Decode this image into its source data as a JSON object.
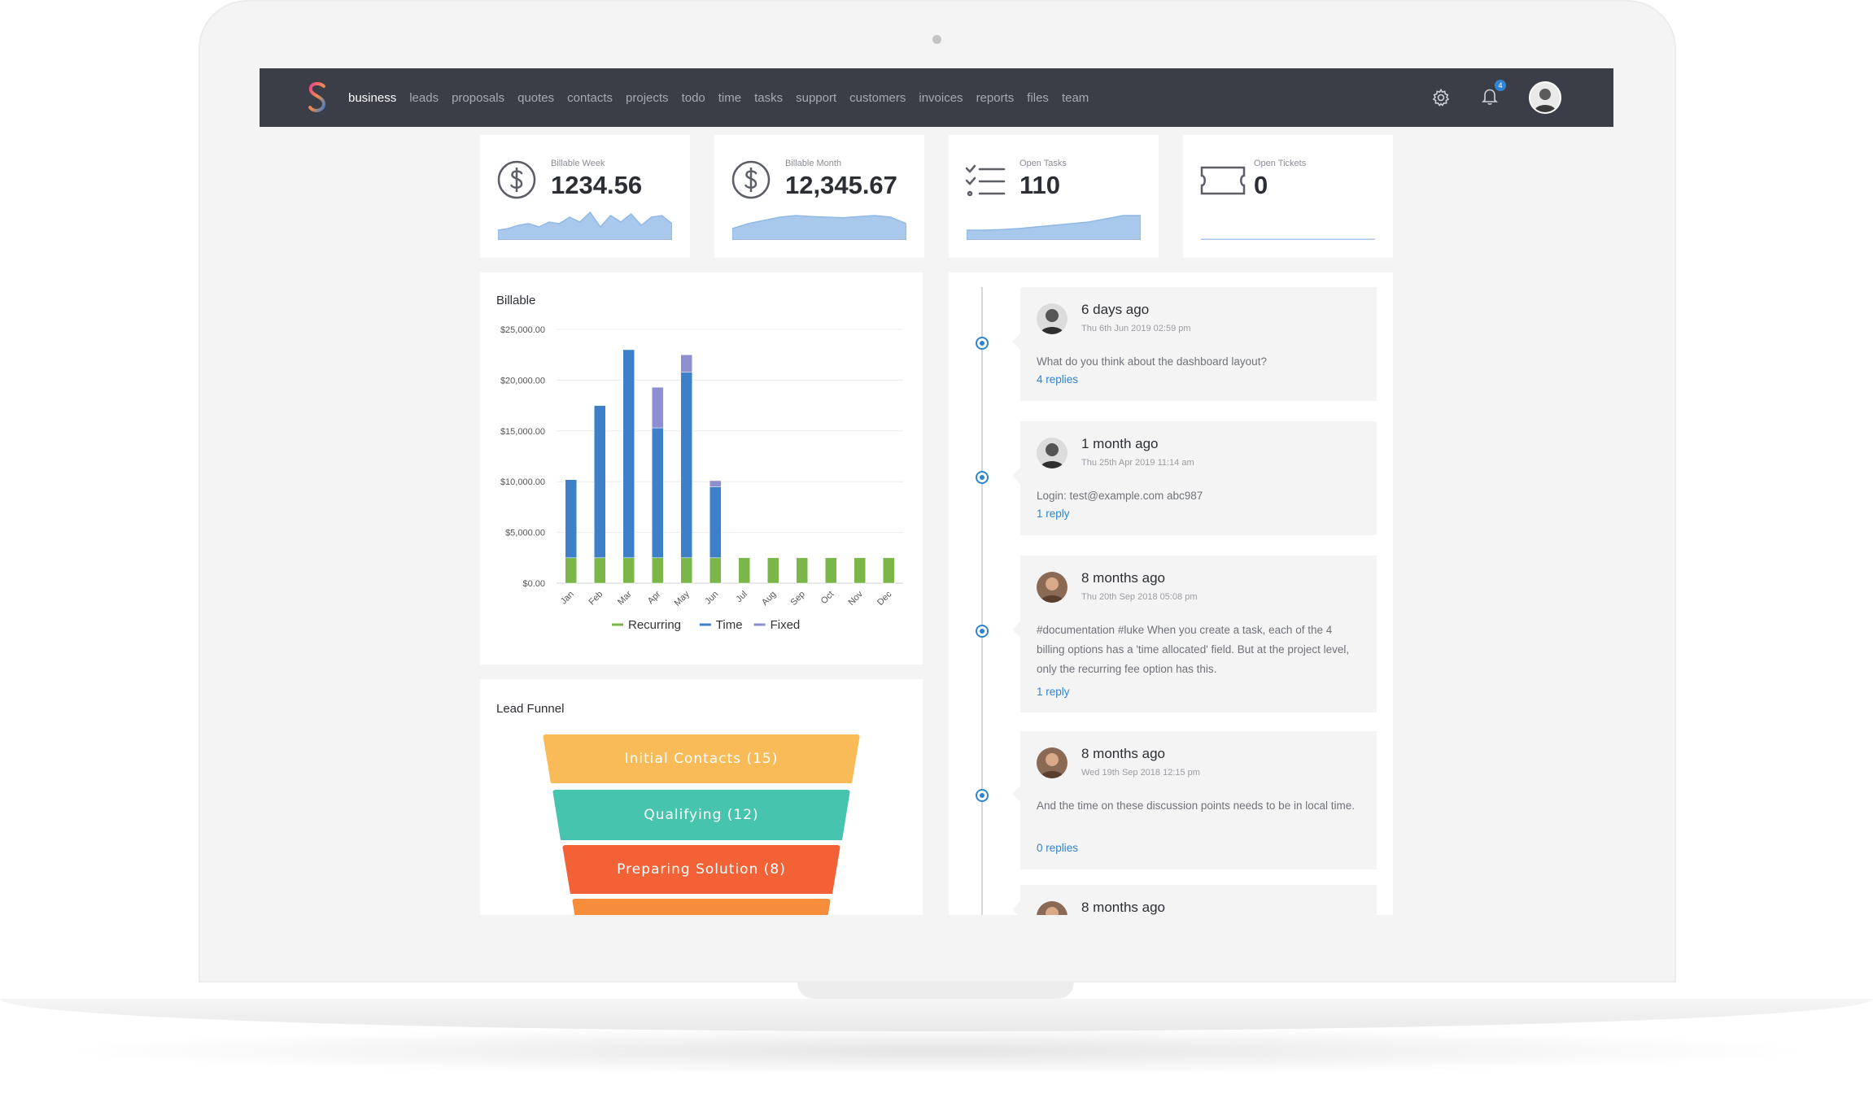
{
  "nav": {
    "items": [
      {
        "label": "business",
        "active": true
      },
      {
        "label": "leads"
      },
      {
        "label": "proposals"
      },
      {
        "label": "quotes"
      },
      {
        "label": "contacts"
      },
      {
        "label": "projects"
      },
      {
        "label": "todo"
      },
      {
        "label": "time"
      },
      {
        "label": "tasks"
      },
      {
        "label": "support"
      },
      {
        "label": "customers"
      },
      {
        "label": "invoices"
      },
      {
        "label": "reports"
      },
      {
        "label": "files"
      },
      {
        "label": "team"
      }
    ],
    "notification_count": "4",
    "icons": [
      "logo-s-icon",
      "settings-gear-icon",
      "bell-icon",
      "avatar"
    ]
  },
  "stats": [
    {
      "label": "Billable Week",
      "value": "1234.56",
      "icon": "dollar-circle-icon"
    },
    {
      "label": "Billable Month",
      "value": "12,345.67",
      "icon": "dollar-circle-icon"
    },
    {
      "label": "Open Tasks",
      "value": "110",
      "icon": "checklist-icon"
    },
    {
      "label": "Open Tickets",
      "value": "0",
      "icon": "ticket-icon"
    }
  ],
  "billable_card": {
    "title": "Billable"
  },
  "lead_funnel": {
    "title": "Lead Funnel",
    "levels": [
      {
        "label": "Initial Contacts (15)",
        "color": "#f8bb57"
      },
      {
        "label": "Qualifying (12)",
        "color": "#47c4ad"
      },
      {
        "label": "Preparing Solution (8)",
        "color": "#f26236"
      },
      {
        "label": "",
        "color": "#f68d3a"
      }
    ]
  },
  "chart_data": {
    "type": "bar",
    "stacked": true,
    "title": "Billable",
    "categories": [
      "Jan",
      "Feb",
      "Mar",
      "Apr",
      "May",
      "Jun",
      "Jul",
      "Aug",
      "Sep",
      "Oct",
      "Nov",
      "Dec"
    ],
    "series": [
      {
        "name": "Recurring",
        "color": "#7ab648",
        "values": [
          2500,
          2500,
          2500,
          2500,
          2500,
          2500,
          2500,
          2500,
          2500,
          2500,
          2500,
          2500
        ]
      },
      {
        "name": "Time",
        "color": "#3d7fc9",
        "values": [
          7700,
          15000,
          20500,
          12800,
          18300,
          7000,
          0,
          0,
          0,
          0,
          0,
          0
        ]
      },
      {
        "name": "Fixed",
        "color": "#8e8fd0",
        "values": [
          0,
          0,
          0,
          4000,
          1700,
          600,
          0,
          0,
          0,
          0,
          0,
          0
        ]
      }
    ],
    "y_ticks": [
      "$0.00",
      "$5,000.00",
      "$10,000.00",
      "$15,000.00",
      "$20,000.00",
      "$25,000.00"
    ],
    "ylim": [
      0,
      25000
    ],
    "legend_position": "bottom",
    "grid": true
  },
  "timeline": [
    {
      "ago": "6 days ago",
      "date": "Thu 6th Jun 2019 02:59 pm",
      "text": "What do you think about the dashboard layout?",
      "replies": "4 replies"
    },
    {
      "ago": "1 month ago",
      "date": "Thu 25th Apr 2019 11:14 am",
      "text": "Login: test@example.com abc987",
      "replies": "1 reply"
    },
    {
      "ago": "8 months ago",
      "date": "Thu 20th Sep 2018 05:08 pm",
      "text": "#documentation #luke When you create a task, each of the 4 billing options has a 'time allocated' field. But at the project level, only the recurring fee option has this.",
      "replies": "1 reply"
    },
    {
      "ago": "8 months ago",
      "date": "Wed 19th Sep 2018 12:15 pm",
      "text": "And the time on these discussion points needs to be in local time.",
      "replies": "0 replies"
    },
    {
      "ago": "8 months ago",
      "date": "",
      "text": "",
      "replies": ""
    }
  ],
  "sparklines": {
    "week": [
      0.3,
      0.35,
      0.45,
      0.5,
      0.4,
      0.55,
      0.5,
      0.7,
      0.55,
      0.85,
      0.4,
      0.75,
      0.55,
      0.8,
      0.45,
      0.7,
      0.75,
      0.5
    ],
    "month": [
      0.35,
      0.5,
      0.6,
      0.7,
      0.75,
      0.72,
      0.7,
      0.68,
      0.72,
      0.75,
      0.7,
      0.5
    ],
    "tasks": [
      0.3,
      0.3,
      0.32,
      0.35,
      0.4,
      0.45,
      0.5,
      0.55,
      0.65,
      0.75,
      0.75
    ],
    "tickets": [
      0.02,
      0.02
    ]
  }
}
